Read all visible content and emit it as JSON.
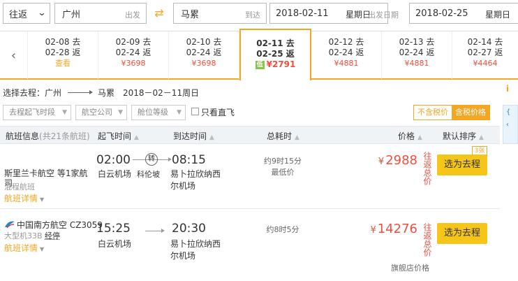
{
  "search": {
    "trip_type": "往返",
    "from_city": "广州",
    "from_hint": "出发",
    "to_city": "马累",
    "to_hint": "到达",
    "depart_date": "2018-02-11",
    "depart_weekday": "星期日",
    "depart_hint": "出发日期",
    "return_date": "2018-02-25",
    "return_weekday": "星期日"
  },
  "date_strip": [
    {
      "go": "02-08 去",
      "back": "02-28 返",
      "price": "查看"
    },
    {
      "go": "02-09 去",
      "back": "02-24 返",
      "price": "¥3698"
    },
    {
      "go": "02-10 去",
      "back": "02-24 返",
      "price": "¥3698"
    },
    {
      "go": "02-11 去",
      "back": "02-25 返",
      "price": "¥2791",
      "badge": "低"
    },
    {
      "go": "02-12 去",
      "back": "02-24 返",
      "price": "¥4881"
    },
    {
      "go": "02-13 去",
      "back": "02-24 返",
      "price": "¥4881"
    },
    {
      "go": "02-14 去",
      "back": "02-27 返",
      "price": "¥4464"
    }
  ],
  "info": {
    "label": "选择去程：广州",
    "dest": "马累",
    "date": "2018－02－11周日",
    "side_icon": "i"
  },
  "filters": {
    "time": "去程起飞时段",
    "airline": "航空公司",
    "cabin": "舱位等级",
    "direct": "只看直飞",
    "tax_excl": "不含税价",
    "tax_incl": "含税价格"
  },
  "table_header": {
    "flight_info": "航班信息",
    "count": "(共21条航班)",
    "dep": "起飞时间",
    "arr": "到达时间",
    "duration": "总耗时",
    "price": "价格",
    "sort": "默认排序"
  },
  "flights": [
    {
      "airline": "斯里兰卡航空 等1家航司",
      "sub": "混程航班",
      "detail": "航班详情",
      "dep_time": "02:00",
      "dep_airport": "白云机场",
      "transfer_badge": "转",
      "via": "科伦坡",
      "arr_time": "08:15",
      "arr_airport": "易卜拉欣纳西尔机场",
      "duration": "约9时15分",
      "note": "最低价",
      "price": "2988",
      "currency": "¥",
      "price_label": "往返总价",
      "select": "选为去程",
      "seats_left": "3张"
    },
    {
      "airline": "中国南方航空 CZ3059",
      "sub": "大型机33B",
      "stop": "经停",
      "detail": "航班详情",
      "dep_time": "15:25",
      "dep_airport": "白云机场",
      "arr_time": "20:30",
      "arr_airport": "易卜拉欣纳西尔机场",
      "duration": "约8时5分",
      "price": "14276",
      "currency": "¥",
      "price_label": "往返总价",
      "select": "选为去程",
      "flagship": "旗舰店价格"
    }
  ],
  "colors": {
    "accent": "#f5a623",
    "price": "#f04e3c",
    "select_button": "#f5c518"
  }
}
